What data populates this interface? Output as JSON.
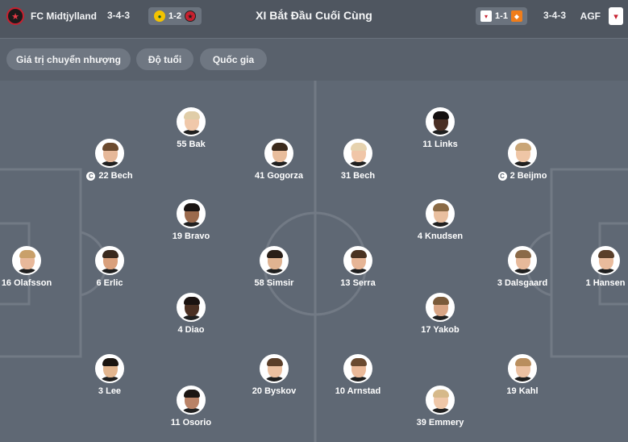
{
  "header": {
    "title": "XI Bắt Đầu Cuối Cùng",
    "home": {
      "name": "FC Midtjylland",
      "formation": "3-4-3",
      "last_result": "1-2"
    },
    "away": {
      "name": "AGF",
      "formation": "3-4-3",
      "last_result": "1-1"
    }
  },
  "filters": [
    {
      "label": "Giá trị chuyển nhượng"
    },
    {
      "label": "Độ tuổi"
    },
    {
      "label": "Quốc gia"
    }
  ],
  "captain_symbol": "C",
  "home_players": [
    {
      "label": "16 Olafsson",
      "captain": false,
      "skin": "#e8b89a",
      "hair": "#c9a06a",
      "shirt": "#1f1f1f"
    },
    {
      "label": "22 Bech",
      "captain": true,
      "skin": "#e6b899",
      "hair": "#6b4a2e",
      "shirt": "#1f1f1f"
    },
    {
      "label": "6 Erlic",
      "captain": false,
      "skin": "#d9a07c",
      "hair": "#3a2a1e",
      "shirt": "#1f1f1f"
    },
    {
      "label": "3 Lee",
      "captain": false,
      "skin": "#e2b58e",
      "hair": "#1b1510",
      "shirt": "#1f1f1f"
    },
    {
      "label": "55 Bak",
      "captain": false,
      "skin": "#f0c8aa",
      "hair": "#e0cda8",
      "shirt": "#1f1f1f"
    },
    {
      "label": "19 Bravo",
      "captain": false,
      "skin": "#9b6a4c",
      "hair": "#1a1412",
      "shirt": "#1f1f1f"
    },
    {
      "label": "4 Diao",
      "captain": false,
      "skin": "#4a2f22",
      "hair": "#1a1210",
      "shirt": "#1f1f1f"
    },
    {
      "label": "11 Osorio",
      "captain": false,
      "skin": "#b98266",
      "hair": "#1b1512",
      "shirt": "#1f1f1f"
    },
    {
      "label": "41 Gogorza",
      "captain": false,
      "skin": "#e8bd9c",
      "hair": "#3b2a1c",
      "shirt": "#1f1f1f"
    },
    {
      "label": "58 Simsir",
      "captain": false,
      "skin": "#e0b391",
      "hair": "#2a1f18",
      "shirt": "#1f1f1f"
    },
    {
      "label": "20 Byskov",
      "captain": false,
      "skin": "#ebc0a0",
      "hair": "#5a3e28",
      "shirt": "#1f1f1f"
    }
  ],
  "away_players": [
    {
      "label": "31 Bech",
      "captain": false,
      "skin": "#f0c6a8",
      "hair": "#e6d2ae",
      "shirt": "#1f1f1f"
    },
    {
      "label": "13 Serra",
      "captain": false,
      "skin": "#e6b596",
      "hair": "#4a3322",
      "shirt": "#1f1f1f"
    },
    {
      "label": "10 Arnstad",
      "captain": false,
      "skin": "#eab999",
      "hair": "#6a4a30",
      "shirt": "#1f1f1f"
    },
    {
      "label": "11 Links",
      "captain": false,
      "skin": "#4a2f24",
      "hair": "#151010",
      "shirt": "#1f1f1f"
    },
    {
      "label": "4 Knudsen",
      "captain": false,
      "skin": "#e9bf9f",
      "hair": "#8a6a45",
      "shirt": "#1f1f1f"
    },
    {
      "label": "17 Yakob",
      "captain": false,
      "skin": "#d9a585",
      "hair": "#7a5a3a",
      "shirt": "#1f1f1f"
    },
    {
      "label": "39 Emmery",
      "captain": false,
      "skin": "#efc7a8",
      "hair": "#d6b98a",
      "shirt": "#1f1f1f"
    },
    {
      "label": "2 Beijmo",
      "captain": true,
      "skin": "#efc6a6",
      "hair": "#c9a576",
      "shirt": "#1f1f1f"
    },
    {
      "label": "3 Dalsgaard",
      "captain": false,
      "skin": "#e7b99a",
      "hair": "#8b6a48",
      "shirt": "#1f1f1f"
    },
    {
      "label": "19 Kahl",
      "captain": false,
      "skin": "#ecc1a2",
      "hair": "#b98e5e",
      "shirt": "#1f1f1f"
    },
    {
      "label": "1 Hansen",
      "captain": false,
      "skin": "#e9bb9c",
      "hair": "#5a3f2a",
      "shirt": "#1f1f1f"
    }
  ],
  "colors": {
    "background": "#5f6874",
    "header": "#4f5660",
    "chip": "#6f7782",
    "pitch_lines": "#727a85"
  }
}
